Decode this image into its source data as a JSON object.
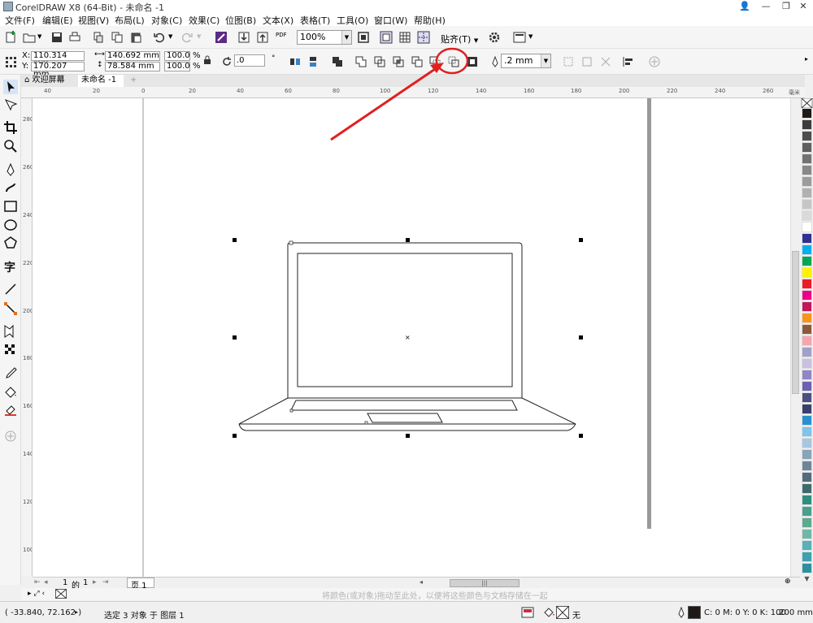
{
  "window": {
    "title": "CorelDRAW X8 (64-Bit) - 未命名 -1",
    "buttons": [
      "👤",
      "—",
      "❐",
      "✕"
    ]
  },
  "menu": {
    "items": [
      "文件(F)",
      "编辑(E)",
      "视图(V)",
      "布局(L)",
      "对象(C)",
      "效果(C)",
      "位图(B)",
      "文本(X)",
      "表格(T)",
      "工具(O)",
      "窗口(W)",
      "帮助(H)"
    ]
  },
  "toolbar1": {
    "zoom": "100%",
    "snap_label": "贴齐(T)",
    "pdf_label": "PDF"
  },
  "propbar": {
    "x_label": "X:",
    "x_value": "110.314 mm",
    "y_label": "Y:",
    "y_value": "170.207 mm",
    "w_value": "140.692 mm",
    "h_value": "78.584 mm",
    "scale_w": "100.0",
    "scale_h": "100.0",
    "percent": "%",
    "rotation": ".0",
    "outline_width": ".2 mm"
  },
  "tabs": {
    "welcome": "欢迎屏幕",
    "document": "未命名 -1",
    "add": "+"
  },
  "rulers": {
    "h_ticks": [
      "40",
      "20",
      "0",
      "20",
      "40",
      "60",
      "80",
      "100",
      "120",
      "140",
      "160",
      "180",
      "200",
      "220",
      "240",
      "260"
    ],
    "h_unit": "毫米",
    "v_ticks": [
      "280",
      "260",
      "240",
      "220",
      "200",
      "180",
      "160",
      "140",
      "120",
      "100"
    ]
  },
  "pagenav": {
    "current": "1",
    "of": "的",
    "total": "1",
    "page_tab": "页 1"
  },
  "hintbar": {
    "text": "将颜色(或对象)拖动至此处，以便将这些颜色与文档存储在一起"
  },
  "status": {
    "coords": "( -33.840, 72.162 )",
    "selection": "选定 3 对象 于 图层 1",
    "fill_none": "无",
    "color_info": "C: 0 M: 0 Y: 0 K: 100",
    "outline_width": ".200 mm"
  },
  "palette_colors": [
    "#1f1a17",
    "#3c3c3c",
    "#4d4d4d",
    "#5f5f5f",
    "#737373",
    "#888888",
    "#9c9c9c",
    "#b1b1b1",
    "#c6c6c6",
    "#dadada",
    "#ffffff",
    "#2e3192",
    "#00aeef",
    "#00a651",
    "#fff200",
    "#ed1c24",
    "#ec008c",
    "#c2185b",
    "#f7941d",
    "#8b5a3c",
    "#f4a6b0",
    "#a0a0c8",
    "#c9c1e0",
    "#8f86c4",
    "#6b61b0",
    "#4a4f7f",
    "#3a3f6b",
    "#2a8fd0",
    "#7fc4ea",
    "#a7c7e0",
    "#8aa4b8",
    "#6d8799",
    "#536b7a",
    "#3d6b6b",
    "#2f8e7e",
    "#4a9e8c",
    "#5fa98f",
    "#71b7a6",
    "#5ab0b8",
    "#3fa0b0",
    "#2f8fa0"
  ],
  "annotation_color": "#e02020"
}
